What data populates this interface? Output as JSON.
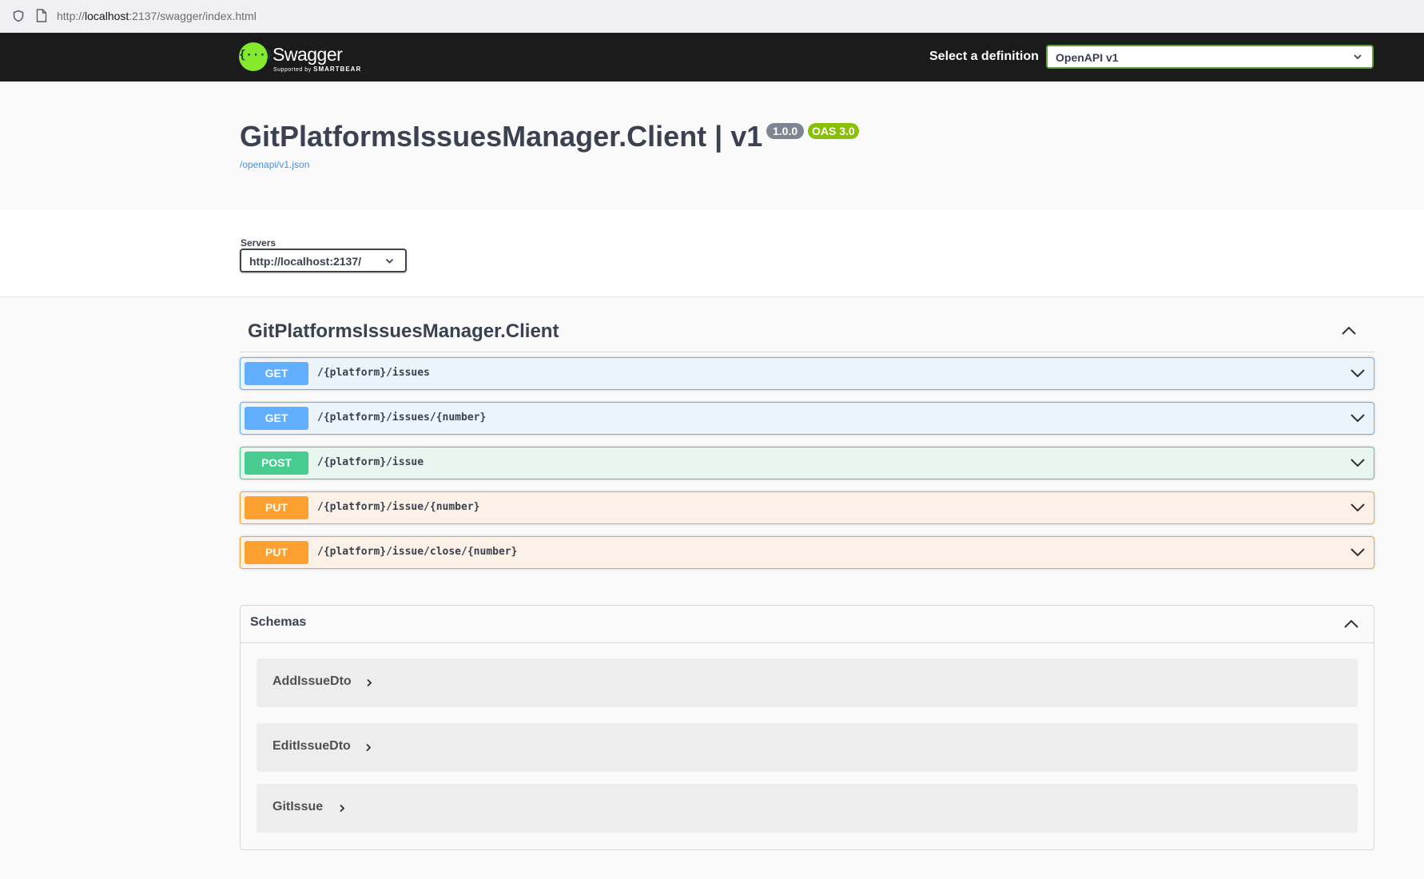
{
  "browser": {
    "url_prefix": "http://",
    "url_host": "localhost",
    "url_rest": ":2137/swagger/index.html"
  },
  "topbar": {
    "logo_text": "Swagger",
    "logo_glyph": "{···}",
    "logo_sub_prefix": "Supported by",
    "logo_sub_brand": "SMARTBEAR",
    "definition_label": "Select a definition",
    "definition_value": "OpenAPI v1"
  },
  "info": {
    "title": "GitPlatformsIssuesManager.Client | v1",
    "version_badge": "1.0.0",
    "oas_badge": "OAS 3.0",
    "spec_link": "/openapi/v1.json"
  },
  "servers": {
    "label": "Servers",
    "value": "http://localhost:2137/"
  },
  "tag": {
    "name": "GitPlatformsIssuesManager.Client",
    "operations": [
      {
        "method": "GET",
        "path": "/{platform}/issues"
      },
      {
        "method": "GET",
        "path": "/{platform}/issues/{number}"
      },
      {
        "method": "POST",
        "path": "/{platform}/issue"
      },
      {
        "method": "PUT",
        "path": "/{platform}/issue/{number}"
      },
      {
        "method": "PUT",
        "path": "/{platform}/issue/close/{number}"
      }
    ]
  },
  "schemas": {
    "title": "Schemas",
    "models": [
      "AddIssueDto",
      "EditIssueDto",
      "GitIssue"
    ]
  },
  "colors": {
    "get": "#61affe",
    "post": "#49cc90",
    "put": "#fca130",
    "topbar_bg": "#1b1b1b",
    "logo_green": "#85ea2d"
  },
  "icons": [
    "shield-icon",
    "page-icon",
    "chevron-down-icon",
    "chevron-up-icon",
    "chevron-right-icon"
  ]
}
